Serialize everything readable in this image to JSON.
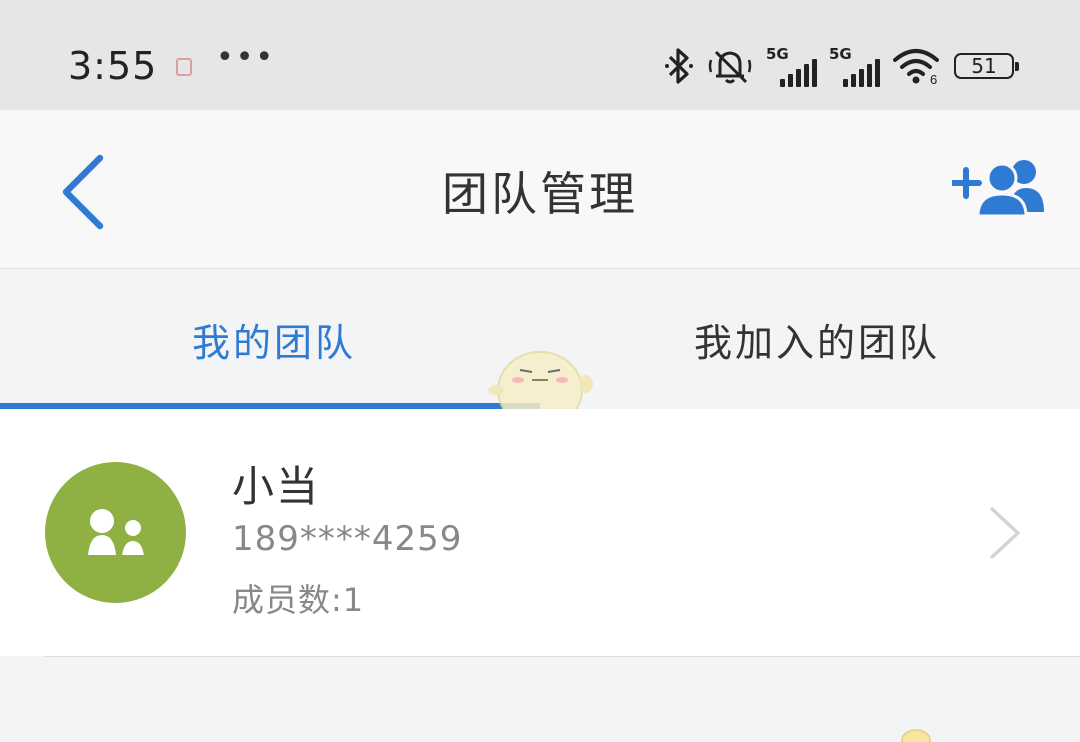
{
  "status_bar": {
    "time": "3:55",
    "more": "•••",
    "network_1": "5G",
    "network_2": "5G",
    "wifi_badge": "6",
    "battery": "51"
  },
  "header": {
    "title": "团队管理",
    "back_icon": "chevron-left-icon",
    "add_icon": "add-team-member-icon",
    "accent": "#2f7bd3"
  },
  "tabs": [
    {
      "label": "我的团队",
      "active": true
    },
    {
      "label": "我加入的团队",
      "active": false
    }
  ],
  "teams": [
    {
      "name": "小当",
      "phone": "189****4259",
      "members": "成员数:1",
      "avatar_color": "#8fb043"
    }
  ]
}
